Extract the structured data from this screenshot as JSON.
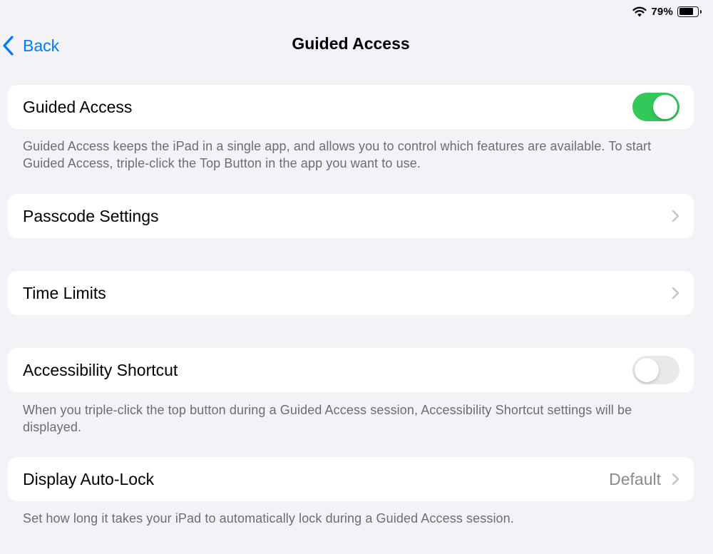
{
  "status_bar": {
    "battery_percent": "79%",
    "battery_level": 0.79,
    "icons": [
      "wifi-icon",
      "battery-icon"
    ]
  },
  "nav": {
    "back_label": "Back",
    "title": "Guided Access"
  },
  "sections": {
    "guided_access": {
      "label": "Guided Access",
      "toggle_on": true,
      "footer": "Guided Access keeps the iPad in a single app, and allows you to control which features are available. To start Guided Access, triple-click the Top Button in the app you want to use."
    },
    "passcode_settings": {
      "label": "Passcode Settings"
    },
    "time_limits": {
      "label": "Time Limits"
    },
    "accessibility_shortcut": {
      "label": "Accessibility Shortcut",
      "toggle_on": false,
      "footer": "When you triple-click the top button during a Guided Access session, Accessibility Shortcut settings will be displayed."
    },
    "display_auto_lock": {
      "label": "Display Auto-Lock",
      "value": "Default",
      "footer": "Set how long it takes your iPad to automatically lock during a Guided Access session."
    }
  },
  "colors": {
    "accent": "#007aff",
    "toggle_on": "#34c759",
    "toggle_off": "#e9e9ea",
    "background": "#f2f2f7",
    "secondary_text": "#6d6d72"
  }
}
